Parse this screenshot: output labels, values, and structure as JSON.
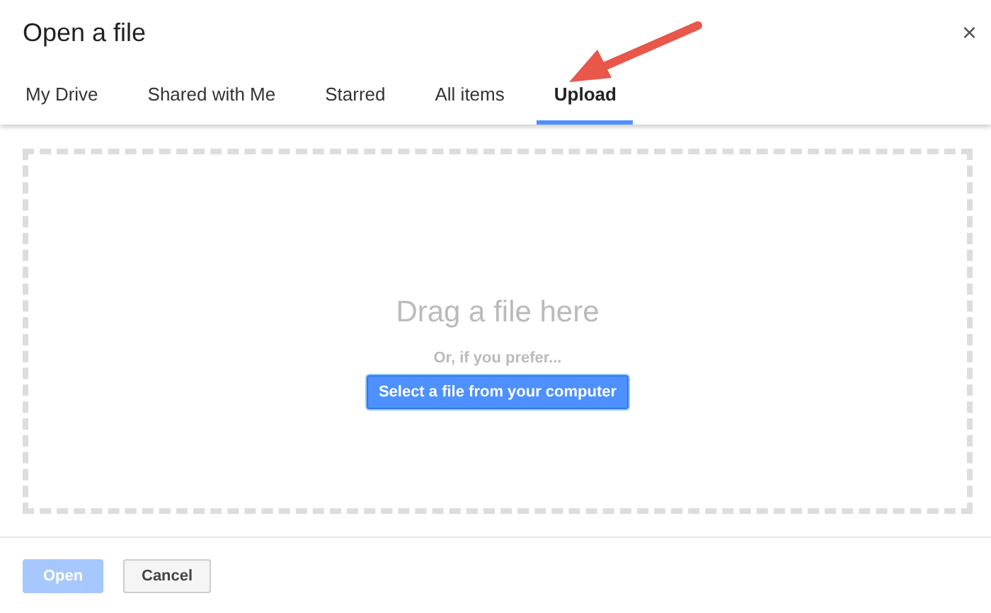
{
  "window": {
    "title": "Open a file",
    "close": "×"
  },
  "tabs": [
    {
      "label": "My Drive",
      "selected": false
    },
    {
      "label": "Shared with Me",
      "selected": false
    },
    {
      "label": "Starred",
      "selected": false
    },
    {
      "label": "All items",
      "selected": false
    },
    {
      "label": "Upload",
      "selected": true
    }
  ],
  "drop_zone": {
    "heading": "Drag a file here",
    "subtext": "Or, if you prefer...",
    "button": "Select a file from your computer"
  },
  "buttons": [
    {
      "label": "Open",
      "kind": "primary",
      "disabled": true
    },
    {
      "label": "Cancel",
      "kind": "secondary",
      "disabled": false
    }
  ]
}
